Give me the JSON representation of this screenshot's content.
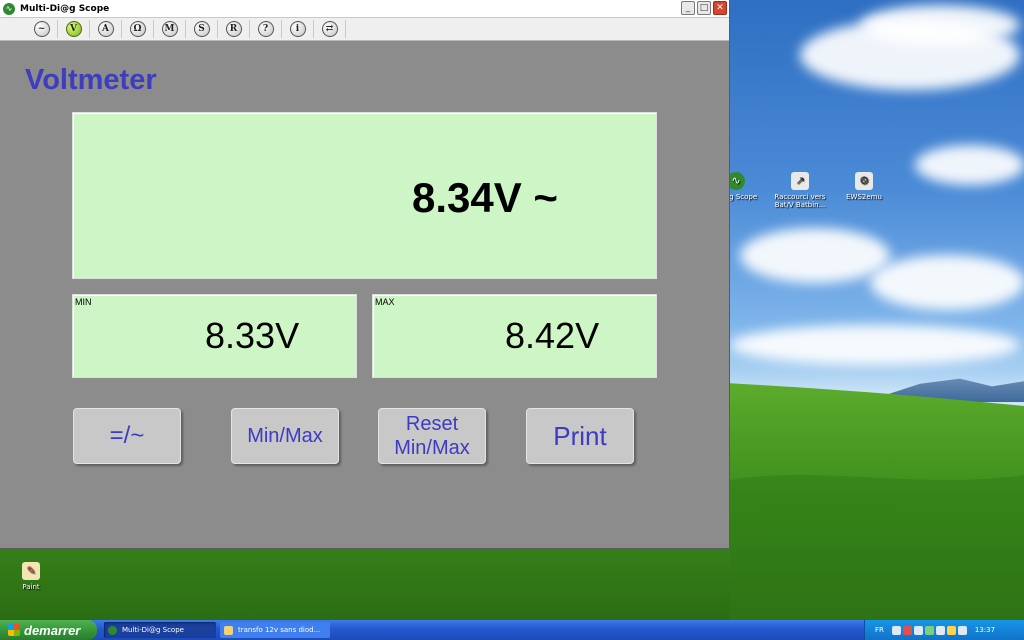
{
  "window": {
    "title": "Multi-Di@g Scope",
    "controls": {
      "minimize": "_",
      "maximize": "□",
      "close": "✕"
    }
  },
  "toolbar": {
    "buttons": [
      {
        "glyph": "~",
        "icon": "wave-icon",
        "active": false
      },
      {
        "glyph": "V",
        "icon": "voltmeter-icon",
        "active": true
      },
      {
        "glyph": "A",
        "icon": "ammeter-icon",
        "active": false
      },
      {
        "glyph": "Ω",
        "icon": "ohmmeter-icon",
        "active": false
      },
      {
        "glyph": "M",
        "icon": "mode-m-icon",
        "active": false
      },
      {
        "glyph": "S",
        "icon": "mode-s-icon",
        "active": false
      },
      {
        "glyph": "R",
        "icon": "mode-r-icon",
        "active": false
      },
      {
        "glyph": "?",
        "icon": "help-icon",
        "active": false
      },
      {
        "glyph": "i",
        "icon": "info-icon",
        "active": false
      },
      {
        "glyph": "⇄",
        "icon": "switch-icon",
        "active": false
      }
    ]
  },
  "meter": {
    "heading": "Voltmeter",
    "value": "8.34V ~",
    "min_caption": "MIN",
    "min_value": "8.33V",
    "max_caption": "MAX",
    "max_value": "8.42V"
  },
  "actions": {
    "mode": "=/~",
    "minmax": "Min/Max",
    "reset_line1": "Reset",
    "reset_line2": "Min/Max",
    "print": "Print"
  },
  "desktop": {
    "icons": [
      {
        "label": "Di@g Scope",
        "icon": "scope-shortcut-icon"
      },
      {
        "label": "Raccourci vers Bat/V Batbin...",
        "icon": "shortcut-icon"
      },
      {
        "label": "EWS2emu",
        "icon": "program-icon"
      },
      {
        "label": "Paint",
        "icon": "paint-icon"
      }
    ]
  },
  "taskbar": {
    "start_label": "demarrer",
    "tasks": [
      {
        "label": "Multi-Di@g Scope",
        "active": true
      },
      {
        "label": "transfo 12v sans diod...",
        "active": false
      }
    ],
    "language": "FR",
    "clock": "13:37"
  },
  "colors": {
    "accent_text": "#3d3dbd",
    "lcd_background": "#cdf5c6",
    "window_background": "#8c8c8c",
    "active_tool": "#7fae12"
  }
}
